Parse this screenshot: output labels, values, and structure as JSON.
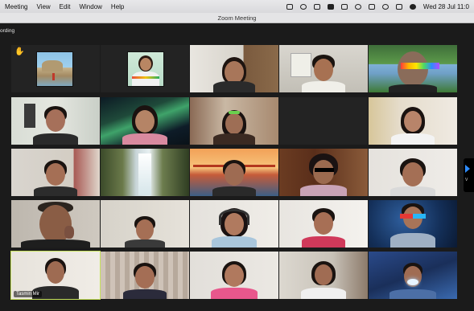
{
  "menubar": {
    "items": [
      "Meeting",
      "View",
      "Edit",
      "Window",
      "Help"
    ],
    "clock": "Wed 28 Jul 11:0"
  },
  "window": {
    "title": "Zoom Meeting"
  },
  "status": {
    "recording_label": "ording"
  },
  "participants": {
    "active_speaker_name": "Tasmin Mir"
  },
  "sidebar_tab": {
    "label": "V"
  },
  "colors": {
    "active_outline": "#c6e25b",
    "raised_hand": "#f2c028"
  }
}
